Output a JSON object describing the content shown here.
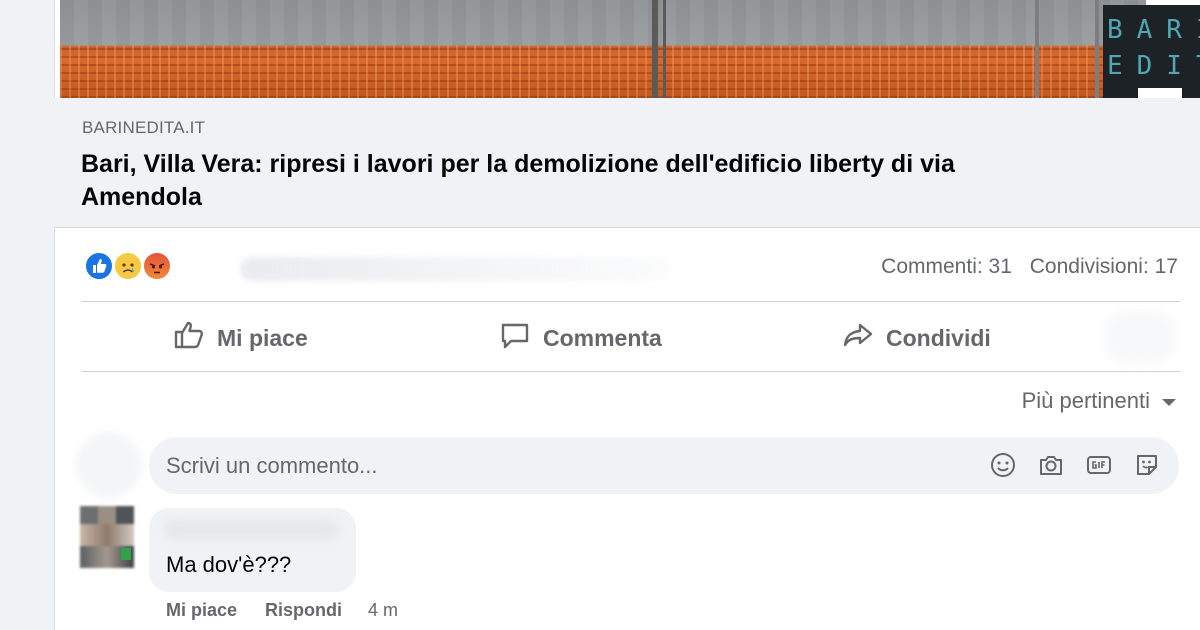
{
  "link_preview": {
    "domain": "BARINEDITA.IT",
    "headline": "Bari, Villa Vera: ripresi i lavori per la demolizione dell'edificio liberty di via Amendola",
    "logo_text_line1": "BARIN",
    "logo_text_line2": "EDITA"
  },
  "reactions": {
    "types": [
      "like",
      "sad",
      "angry"
    ]
  },
  "counts": {
    "comments": "Commenti: 31",
    "shares": "Condivisioni: 17"
  },
  "actions": {
    "like": "Mi piace",
    "comment": "Commenta",
    "share": "Condividi"
  },
  "sort": {
    "label": "Più pertinenti"
  },
  "composer": {
    "placeholder": "Scrivi un commento...",
    "icons": [
      "emoji-icon",
      "camera-icon",
      "gif-icon",
      "sticker-icon"
    ]
  },
  "comment": {
    "text": "Ma dov'è???",
    "like_label": "Mi piace",
    "reply_label": "Rispondi",
    "time": "4 m"
  },
  "colors": {
    "accent": "#1b74e4",
    "secondary_text": "#65676b",
    "online": "#31a24c"
  }
}
